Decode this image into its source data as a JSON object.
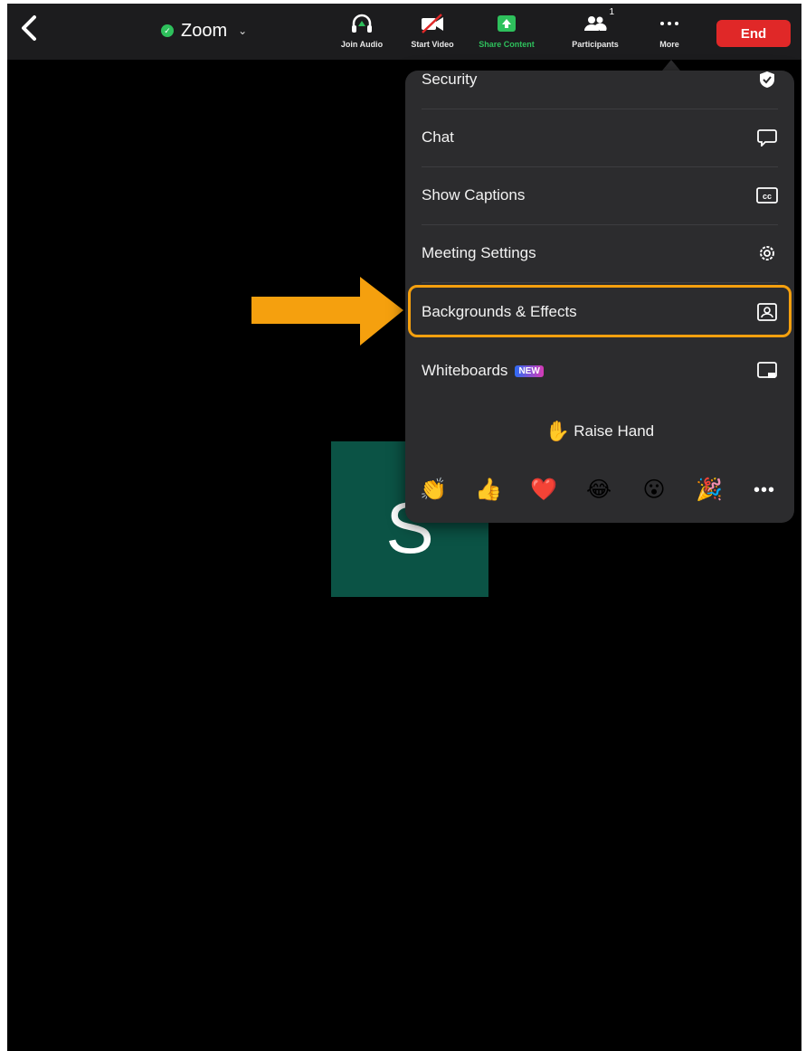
{
  "toolbar": {
    "meeting_name": "Zoom",
    "join_audio_label": "Join Audio",
    "start_video_label": "Start Video",
    "share_content_label": "Share Content",
    "participants_label": "Participants",
    "participants_count": "1",
    "more_label": "More",
    "end_label": "End"
  },
  "menu": {
    "items": [
      {
        "label": "Security",
        "icon": "shield-icon"
      },
      {
        "label": "Chat",
        "icon": "chat-bubble-icon"
      },
      {
        "label": "Show Captions",
        "icon": "cc-icon"
      },
      {
        "label": "Meeting Settings",
        "icon": "gear-icon"
      },
      {
        "label": "Backgrounds & Effects",
        "icon": "portrait-frame-icon"
      },
      {
        "label": "Whiteboards",
        "badge": "NEW",
        "icon": "whiteboard-icon"
      }
    ],
    "raise_hand_label": "Raise Hand",
    "reactions": [
      "👏",
      "👍",
      "❤️",
      "😂",
      "😮",
      "🎉"
    ]
  },
  "participant": {
    "initial": "S"
  },
  "colors": {
    "highlight": "#f5a00e",
    "arrow": "#f5a00e",
    "end": "#e02828",
    "share": "#2ec05c",
    "tile": "#0b5345"
  }
}
